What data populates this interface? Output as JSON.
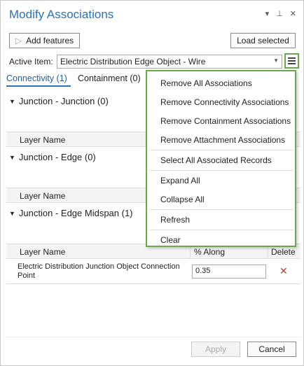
{
  "window": {
    "title": "Modify Associations"
  },
  "toolbar": {
    "add_features": "Add features",
    "load_selected": "Load selected"
  },
  "active_item": {
    "label": "Active Item:",
    "value": "Electric Distribution Edge Object - Wire"
  },
  "tabs": [
    {
      "label": "Connectivity (1)"
    },
    {
      "label": "Containment (0)"
    }
  ],
  "sections": [
    {
      "title": "Junction - Junction (0)"
    },
    {
      "title": "Junction - Edge (0)"
    },
    {
      "title": "Junction - Edge Midspan (1)"
    }
  ],
  "table": {
    "col_layer": "Layer Name",
    "col_along": "% Along",
    "col_delete": "Delete",
    "row": {
      "layer": "Electric Distribution Junction Object Connection Point",
      "along": "0.35"
    }
  },
  "menu": {
    "items": [
      "Remove All Associations",
      "Remove Connectivity Associations",
      "Remove Containment Associations",
      "Remove Attachment Associations",
      "Select All Associated Records",
      "Expand All",
      "Collapse All",
      "Refresh",
      "Clear"
    ]
  },
  "footer": {
    "apply": "Apply",
    "cancel": "Cancel"
  },
  "colors": {
    "accent": "#2b72b8",
    "highlight": "#6aa84f",
    "delete": "#c0392b"
  }
}
